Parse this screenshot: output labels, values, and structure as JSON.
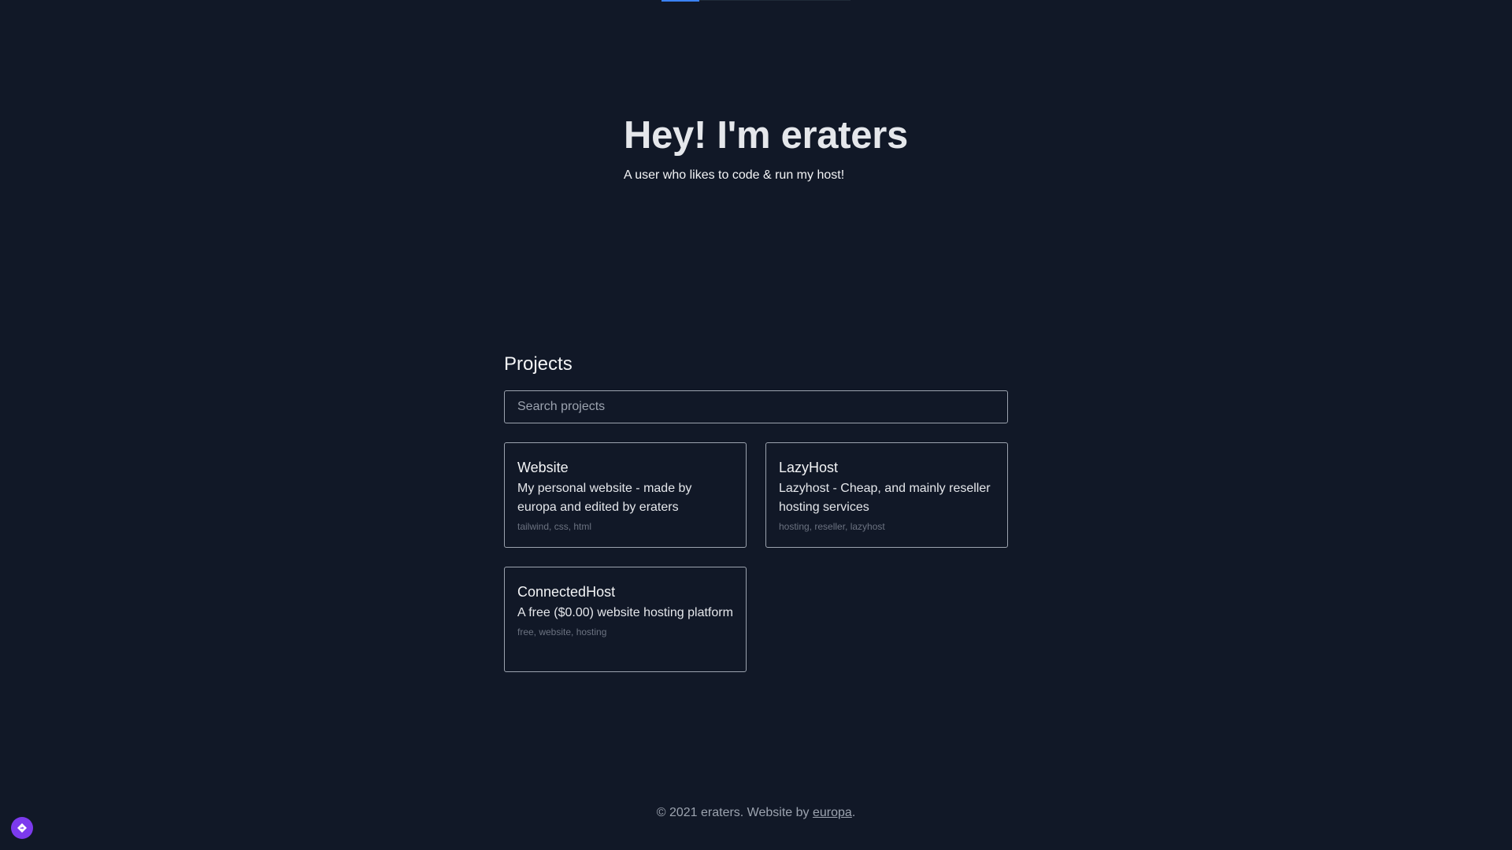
{
  "hero": {
    "title": "Hey! I'm eraters",
    "subtitle": "A user who likes to code & run my host!"
  },
  "projects": {
    "heading": "Projects",
    "search_placeholder": "Search projects",
    "items": [
      {
        "title": "Website",
        "description": "My personal website - made by europa and edited by eraters",
        "tags": "tailwind, css, html"
      },
      {
        "title": "LazyHost",
        "description": "Lazyhost - Cheap, and mainly reseller hosting services",
        "tags": "hosting, reseller, lazyhost"
      },
      {
        "title": "ConnectedHost",
        "description": "A free ($0.00) website hosting platform",
        "tags": "free, website, hosting"
      }
    ]
  },
  "footer": {
    "prefix": "© 2021 eraters. Website by ",
    "link": "europa",
    "suffix": "."
  },
  "colors": {
    "background": "#111827",
    "card_border": "#9ca3af",
    "accent": "#3b82f6",
    "fab": "#7c3aed"
  },
  "icons": {
    "fab": "diamond-arrow-icon"
  }
}
